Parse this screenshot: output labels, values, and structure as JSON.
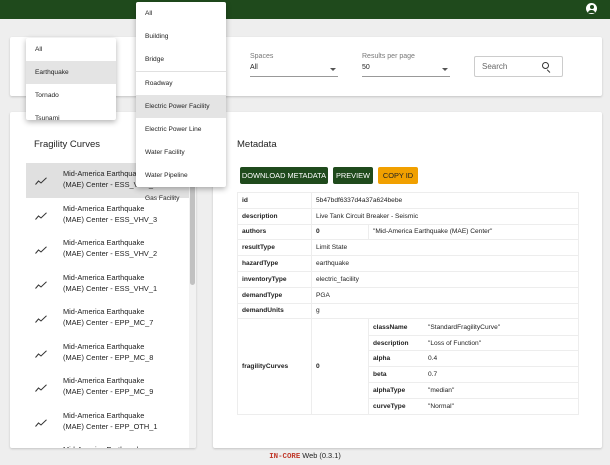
{
  "filters": {
    "spaces_label": "Spaces",
    "spaces_value": "All",
    "results_label": "Results per page",
    "results_value": "50",
    "search_placeholder": "Search"
  },
  "hazard_menu": {
    "options": [
      "All",
      "Earthquake",
      "Tornado",
      "Tsunami"
    ],
    "highlighted": "Earthquake"
  },
  "inventory_menu": {
    "options": [
      "All",
      "Building",
      "Bridge",
      "Roadway",
      "Electric Power Facility",
      "Electric Power Line",
      "Water Facility",
      "Water Pipeline",
      "Gas Facility"
    ],
    "highlighted": "Electric Power Facility"
  },
  "list": {
    "title": "Fragility Curves",
    "items": [
      {
        "line1": "Mid-America Earthquake",
        "line2": "(MAE) Center - ESS_VHV_4",
        "selected": true
      },
      {
        "line1": "Mid-America Earthquake",
        "line2": "(MAE) Center - ESS_VHV_3"
      },
      {
        "line1": "Mid-America Earthquake",
        "line2": "(MAE) Center - ESS_VHV_2"
      },
      {
        "line1": "Mid-America Earthquake",
        "line2": "(MAE) Center - ESS_VHV_1"
      },
      {
        "line1": "Mid-America Earthquake",
        "line2": "(MAE) Center - EPP_MC_7"
      },
      {
        "line1": "Mid-America Earthquake",
        "line2": "(MAE) Center - EPP_MC_8"
      },
      {
        "line1": "Mid-America Earthquake",
        "line2": "(MAE) Center - EPP_MC_9"
      },
      {
        "line1": "Mid-America Earthquake",
        "line2": "(MAE) Center - EPP_OTH_1"
      },
      {
        "line1": "Mid-America Earthquake",
        "line2": ""
      }
    ]
  },
  "metadata": {
    "title": "Metadata",
    "buttons": {
      "download": "DOWNLOAD METADATA",
      "preview": "PREVIEW",
      "copy": "COPY ID"
    },
    "id_label": "id",
    "id_value": "5b47bdf6337d4a37a624bebe",
    "description_label": "description",
    "description_value": "Live Tank Circuit Breaker - Seismic",
    "authors_label": "authors",
    "authors_index": "0",
    "authors_value": "\"Mid-America Earthquake (MAE) Center\"",
    "resultType_label": "resultType",
    "resultType_value": "Limit State",
    "hazardType_label": "hazardType",
    "hazardType_value": "earthquake",
    "inventoryType_label": "inventoryType",
    "inventoryType_value": "electric_facility",
    "demandType_label": "demandType",
    "demandType_value": "PGA",
    "demandUnits_label": "demandUnits",
    "demandUnits_value": "g",
    "fragilityCurves_label": "fragilityCurves",
    "fragilityCurves_index": "0",
    "curve": {
      "className_label": "className",
      "className_value": "\"StandardFragilityCurve\"",
      "description_label": "description",
      "description_value": "\"Loss of Function\"",
      "alpha_label": "alpha",
      "alpha_value": "0.4",
      "beta_label": "beta",
      "beta_value": "0.7",
      "alphaType_label": "alphaType",
      "alphaType_value": "\"median\"",
      "curveType_label": "curveType",
      "curveType_value": "\"Normal\""
    }
  },
  "footer": {
    "brand": "IN-CORE",
    "text": " Web (0.3.1)"
  }
}
